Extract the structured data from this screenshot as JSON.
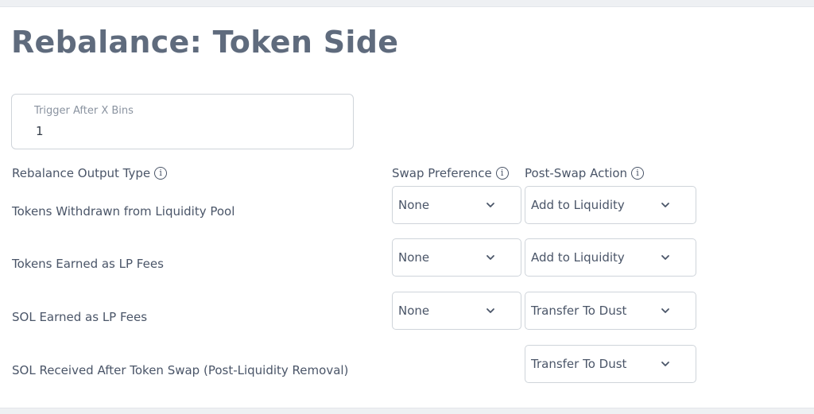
{
  "page": {
    "title": "Rebalance: Token Side"
  },
  "trigger": {
    "label": "Trigger After X Bins",
    "value": "1"
  },
  "headers": {
    "output_type": "Rebalance Output Type",
    "swap_preference": "Swap Preference",
    "post_swap_action": "Post-Swap Action"
  },
  "rows": [
    {
      "label": "Tokens Withdrawn from Liquidity Pool",
      "swap_preference": "None",
      "post_swap_action": "Add to Liquidity"
    },
    {
      "label": "Tokens Earned as LP Fees",
      "swap_preference": "None",
      "post_swap_action": "Add to Liquidity"
    },
    {
      "label": "SOL Earned as LP Fees",
      "swap_preference": "None",
      "post_swap_action": "Transfer To Dust"
    },
    {
      "label": "SOL Received After Token Swap (Post-Liquidity Removal)",
      "post_swap_action": "Transfer To Dust"
    }
  ],
  "icons": {
    "info": "info-icon",
    "dropdown": "chevron-down-icon"
  }
}
